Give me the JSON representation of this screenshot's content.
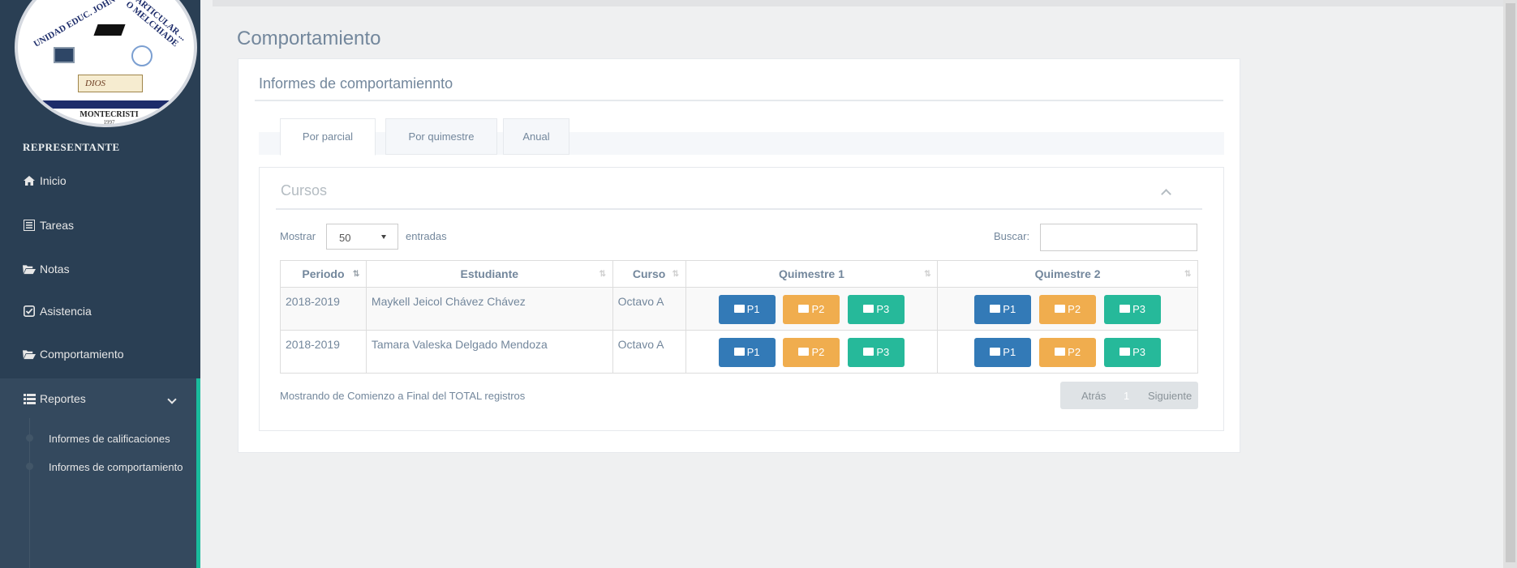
{
  "sidebar": {
    "logo": {
      "ring_left": "UNIDAD EDUC. JOHN PIERRE",
      "ring_right": "PARTICULAR ... O MELCHIADE",
      "book_text": "DIOS",
      "city": "MONTECRISTI",
      "year": "1997"
    },
    "role": "REPRESENTANTE",
    "items": [
      {
        "label": "Inicio",
        "icon": "home-icon"
      },
      {
        "label": "Tareas",
        "icon": "list-icon"
      },
      {
        "label": "Notas",
        "icon": "folder-open-icon"
      },
      {
        "label": "Asistencia",
        "icon": "check-square-icon"
      },
      {
        "label": "Comportamiento",
        "icon": "folder-open-icon"
      },
      {
        "label": "Reportes",
        "icon": "list-icon"
      }
    ],
    "submenu": [
      {
        "label": "Informes de calificaciones"
      },
      {
        "label": "Informes de comportamiento"
      }
    ]
  },
  "page": {
    "title": "Comportamiento",
    "panel_title": "Informes de comportamiennto"
  },
  "tabs": [
    {
      "label": "Por parcial",
      "active": true
    },
    {
      "label": "Por quimestre",
      "active": false
    },
    {
      "label": "Anual",
      "active": false
    }
  ],
  "cursos": {
    "title": "Cursos",
    "length_label_before": "Mostrar",
    "length_value": "50",
    "length_label_after": "entradas",
    "search_label": "Buscar:",
    "search_value": "",
    "columns": [
      "Periodo",
      "Estudiante",
      "Curso",
      "Quimestre 1",
      "Quimestre 2"
    ],
    "rows": [
      {
        "periodo": "2018-2019",
        "estudiante": "Maykell Jeicol Chávez Chávez",
        "curso": "Octavo A"
      },
      {
        "periodo": "2018-2019",
        "estudiante": "Tamara Valeska Delgado Mendoza",
        "curso": "Octavo A"
      }
    ],
    "buttons": {
      "p1": "P1",
      "p2": "P2",
      "p3": "P3"
    },
    "info": "Mostrando de Comienzo a Final del TOTAL registros",
    "pager": {
      "prev": "Atrás",
      "current": "1",
      "next": "Siguiente"
    }
  },
  "colors": {
    "sidebar_bg": "#2a3f54",
    "accent": "#1abb9c",
    "btn_primary": "#337ab7",
    "btn_warning": "#f0ad4e",
    "btn_success": "#26b99a"
  }
}
